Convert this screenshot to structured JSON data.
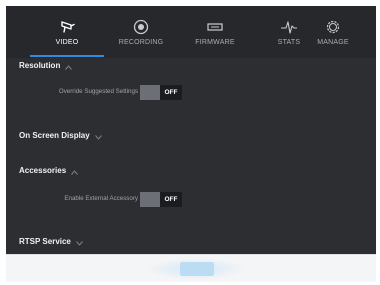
{
  "nav": {
    "tabs": [
      {
        "label": "VIDEO",
        "icon": "video-camera-icon",
        "active": true
      },
      {
        "label": "RECORDING",
        "icon": "record-icon",
        "active": false
      },
      {
        "label": "FIRMWARE",
        "icon": "firmware-icon",
        "active": false
      },
      {
        "label": "STATS",
        "icon": "pulse-icon",
        "active": false
      },
      {
        "label": "MANAGE",
        "icon": "gear-icon",
        "active": false
      }
    ]
  },
  "sections": {
    "resolution": {
      "title": "Resolution",
      "expanded": true,
      "override_label": "Override Suggested Settings",
      "override_state": "OFF"
    },
    "osd": {
      "title": "On Screen Display",
      "expanded": false
    },
    "accessories": {
      "title": "Accessories",
      "expanded": true,
      "external_label": "Enable External Accessory",
      "external_state": "OFF"
    },
    "rtsp": {
      "title": "RTSP Service",
      "expanded": false
    }
  },
  "footer": {
    "apply_label": ""
  },
  "colors": {
    "accent": "#2f8ae0",
    "background": "#2c2e32",
    "nav_background": "#26282c",
    "toggle_off": "#1b1c1f"
  }
}
